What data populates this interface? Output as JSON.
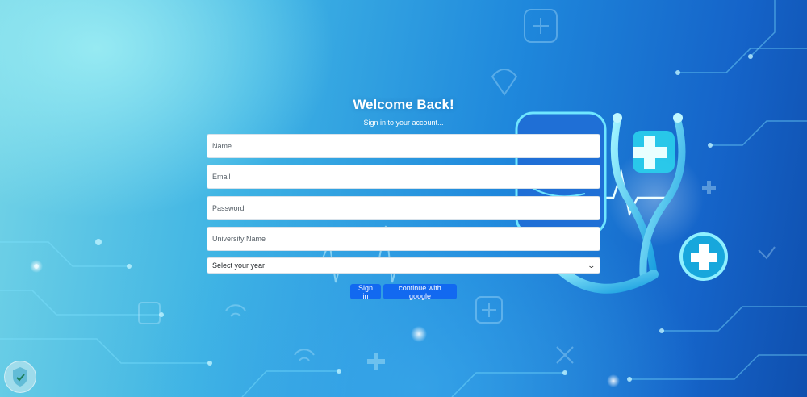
{
  "login": {
    "title": "Welcome Back!",
    "subtitle": "Sign in to your account...",
    "name_placeholder": "Name",
    "email_placeholder": "Email",
    "password_placeholder": "Password",
    "university_placeholder": "University Name",
    "year_select_value": "Select your year",
    "signin_label": "Sign in",
    "google_label": "continue with google"
  },
  "theme": {
    "button_color": "#1269f0",
    "background_start": "#74d4e6",
    "background_end": "#0f4fae"
  },
  "icons": [
    "stethoscope-illustration",
    "medical-cross-icon",
    "heart-icon",
    "wifi-icon",
    "site-logo",
    "chevron-down-icon"
  ]
}
